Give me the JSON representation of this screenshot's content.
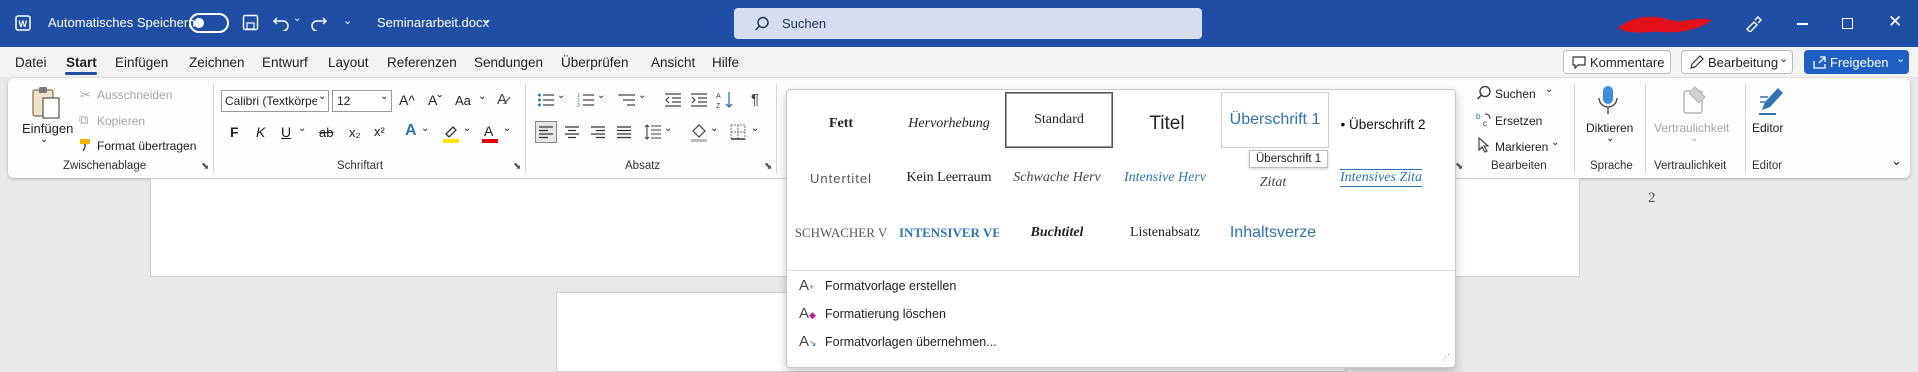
{
  "titlebar": {
    "autosave_label": "Automatisches Speichern",
    "document_name": "Seminararbeit.docx",
    "search_placeholder": "Suchen"
  },
  "menu": {
    "tabs": [
      "Datei",
      "Start",
      "Einfügen",
      "Zeichnen",
      "Entwurf",
      "Layout",
      "Referenzen",
      "Sendungen",
      "Überprüfen",
      "Ansicht",
      "Hilfe"
    ],
    "active_tab": "Start",
    "comments_label": "Kommentare",
    "editing_label": "Bearbeitung",
    "share_label": "Freigeben"
  },
  "ribbon": {
    "clipboard": {
      "paste_label": "Einfügen",
      "cut_label": "Ausschneiden",
      "copy_label": "Kopieren",
      "format_painter_label": "Format übertragen",
      "group_label": "Zwischenablage"
    },
    "font": {
      "font_name": "Calibri (Textkörpe",
      "font_size": "12",
      "grow": "A^",
      "shrink": "Aˇ",
      "case": "Aa",
      "bold": "F",
      "italic": "K",
      "underline": "U",
      "strike": "ab",
      "subscript": "x₂",
      "superscript": "x²",
      "group_label": "Schriftart"
    },
    "paragraph": {
      "group_label": "Absatz"
    },
    "editing": {
      "find_label": "Suchen",
      "replace_label": "Ersetzen",
      "select_label": "Markieren",
      "group_label": "Bearbeiten"
    },
    "voice": {
      "dictate_label": "Diktieren",
      "group_label": "Sprache"
    },
    "sensitivity": {
      "label": "Vertraulichkeit",
      "group_label": "Vertraulichkeit"
    },
    "editor": {
      "label": "Editor",
      "group_label": "Editor"
    }
  },
  "document": {
    "page_number": "2"
  },
  "styles_gallery": {
    "rows": [
      [
        "Fett",
        "Hervorhebung",
        "Standard",
        "Titel",
        "Überschrift 1",
        "• Überschrift 2"
      ],
      [
        "Untertitel",
        "Kein Leerraum",
        "Schwache Herv",
        "Intensive Herv",
        "Zitat",
        "Intensives Zita"
      ],
      [
        "SCHWACHER V",
        "INTENSIVER VE",
        "Buchtitel",
        "Listenabsatz",
        "Inhaltsverze",
        ""
      ]
    ],
    "tooltip": "Überschrift 1",
    "menu_items": [
      {
        "icon": "create-style-icon",
        "label": "Formatvorlage erstellen"
      },
      {
        "icon": "clear-formatting-icon",
        "label": "Formatierung löschen"
      },
      {
        "icon": "apply-styles-icon",
        "label": "Formatvorlagen übernehmen..."
      }
    ]
  },
  "colors": {
    "titlebar": "#1e4fa5",
    "accent": "#1e4fa5",
    "heading_blue": "#2e74b5",
    "highlight_yellow": "#ffe600",
    "font_red": "#e00000"
  }
}
